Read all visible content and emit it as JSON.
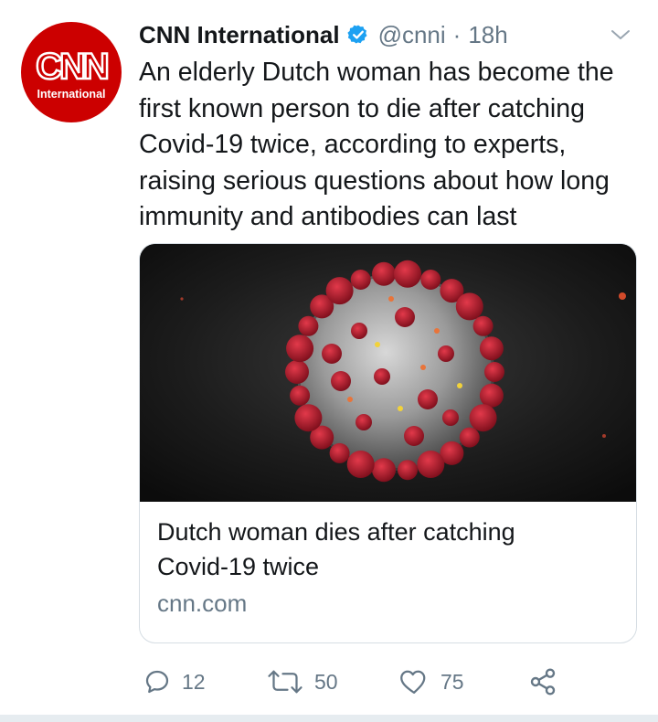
{
  "tweet": {
    "display_name": "CNN International",
    "handle": "@cnni",
    "separator": "·",
    "time": "18h",
    "verified_icon": "verified-badge-icon",
    "text": "An elderly Dutch woman has become the\nfirst known person to die after catching\nCovid-19 twice, according to experts,\nraising serious questions about how long\nimmunity and antibodies can last"
  },
  "avatar": {
    "logo_main": "CNN",
    "logo_sub": "International",
    "color": "#cc0000"
  },
  "card": {
    "image_icon": "coronavirus-illustration",
    "title": "Dutch woman dies after catching\nCovid-19 twice",
    "domain": "cnn.com"
  },
  "actions": {
    "reply_count": "12",
    "retweet_count": "50",
    "like_count": "75"
  },
  "colors": {
    "accent": "#1da1f2",
    "muted": "#657786",
    "text": "#14171a",
    "brand": "#cc0000"
  }
}
